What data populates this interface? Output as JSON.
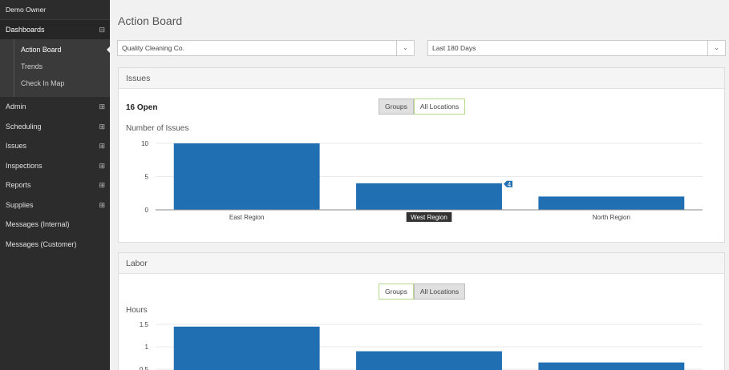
{
  "sidebar": {
    "owner": "Demo Owner",
    "items": [
      {
        "label": "Dashboards",
        "toggle": "⊟"
      },
      {
        "label": "Admin",
        "toggle": "⊞"
      },
      {
        "label": "Scheduling",
        "toggle": "⊞"
      },
      {
        "label": "Issues",
        "toggle": "⊞"
      },
      {
        "label": "Inspections",
        "toggle": "⊞"
      },
      {
        "label": "Reports",
        "toggle": "⊞"
      },
      {
        "label": "Supplies",
        "toggle": "⊞"
      },
      {
        "label": "Messages (Internal)"
      },
      {
        "label": "Messages (Customer)"
      }
    ],
    "subitems": [
      {
        "label": "Action Board"
      },
      {
        "label": "Trends"
      },
      {
        "label": "Check In Map"
      }
    ]
  },
  "header": {
    "title": "Action Board"
  },
  "filters": {
    "company": "Quality Cleaning Co.",
    "range": "Last 180 Days",
    "caret": "⌄"
  },
  "issues": {
    "panel_title": "Issues",
    "open_count": "16 Open",
    "groups_label": "Groups",
    "locations_label": "All Locations",
    "chart_title": "Number of Issues"
  },
  "labor": {
    "panel_title": "Labor",
    "groups_label": "Groups",
    "locations_label": "All Locations",
    "chart_title": "Hours"
  },
  "colors": {
    "bar": "#1f6fb2"
  },
  "chart_data": [
    {
      "type": "bar",
      "title": "Number of Issues",
      "categories": [
        "East Region",
        "West Region",
        "North Region"
      ],
      "values": [
        10,
        4,
        2
      ],
      "yticks": [
        0,
        5,
        10
      ],
      "ylim": [
        0,
        10
      ],
      "tooltip": {
        "category": "West Region",
        "value": "4"
      },
      "grid": true
    },
    {
      "type": "bar",
      "title": "Hours",
      "values": [
        1.45,
        0.9,
        0.65
      ],
      "yticks": [
        0.5,
        1,
        1.5
      ],
      "ylim": [
        0,
        1.5
      ],
      "grid": true
    }
  ]
}
